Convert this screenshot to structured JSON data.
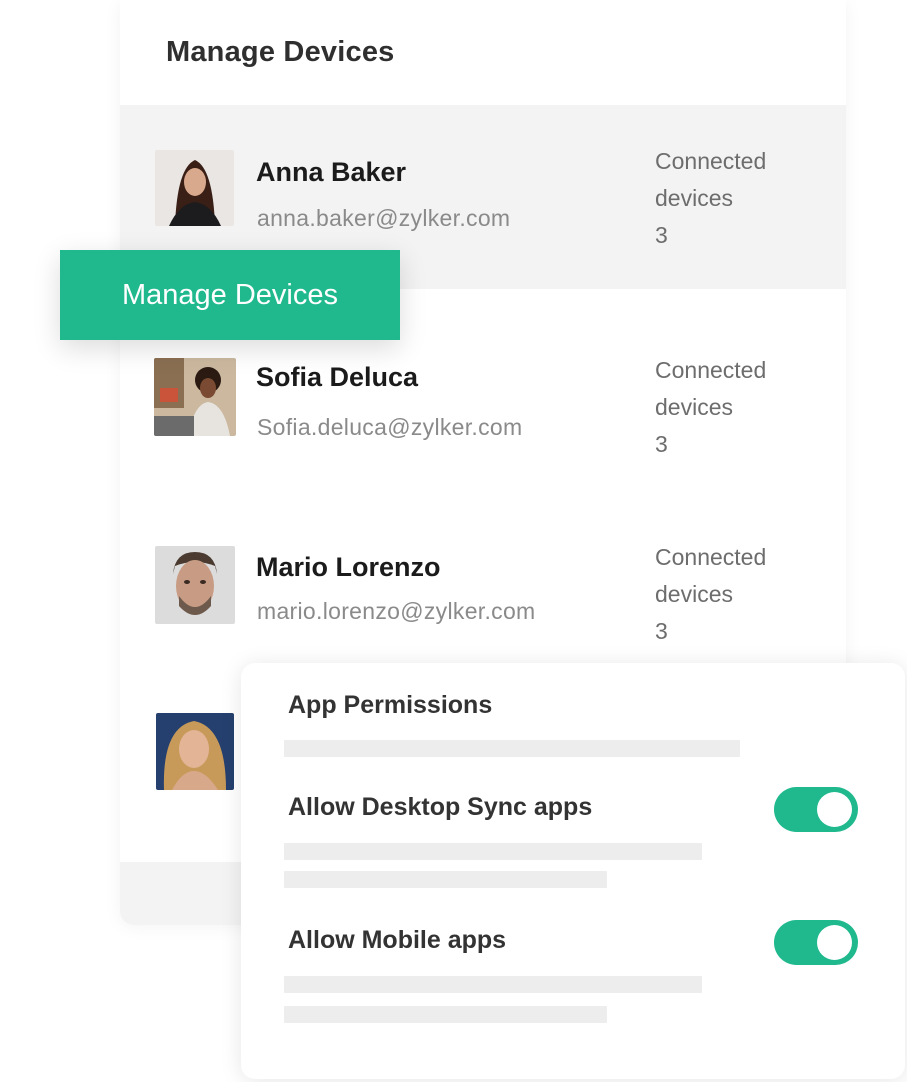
{
  "page": {
    "title": "Manage Devices"
  },
  "cta": {
    "label": "Manage Devices",
    "color": "#20b98e"
  },
  "users": [
    {
      "name": "Anna Baker",
      "email": "anna.baker@zylker.com",
      "devices_label": "Connected devices",
      "devices_count": "3",
      "avatar": "anna-baker-photo",
      "highlighted": true
    },
    {
      "name": "Sofia Deluca",
      "email": "Sofia.deluca@zylker.com",
      "devices_label": "Connected devices",
      "devices_count": "3",
      "avatar": "sofia-deluca-photo"
    },
    {
      "name": "Mario Lorenzo",
      "email": "mario.lorenzo@zylker.com",
      "devices_label": "Connected devices",
      "devices_count": "3",
      "avatar": "mario-lorenzo-photo"
    },
    {
      "avatar": "fourth-user-photo"
    }
  ],
  "permissions": {
    "title": "App Permissions",
    "items": [
      {
        "label": "Allow Desktop Sync apps",
        "enabled": true
      },
      {
        "label": "Allow Mobile apps",
        "enabled": true
      }
    ]
  },
  "colors": {
    "accent": "#20b98e",
    "row_highlight": "#f3f3f3",
    "skeleton": "#ededed"
  }
}
